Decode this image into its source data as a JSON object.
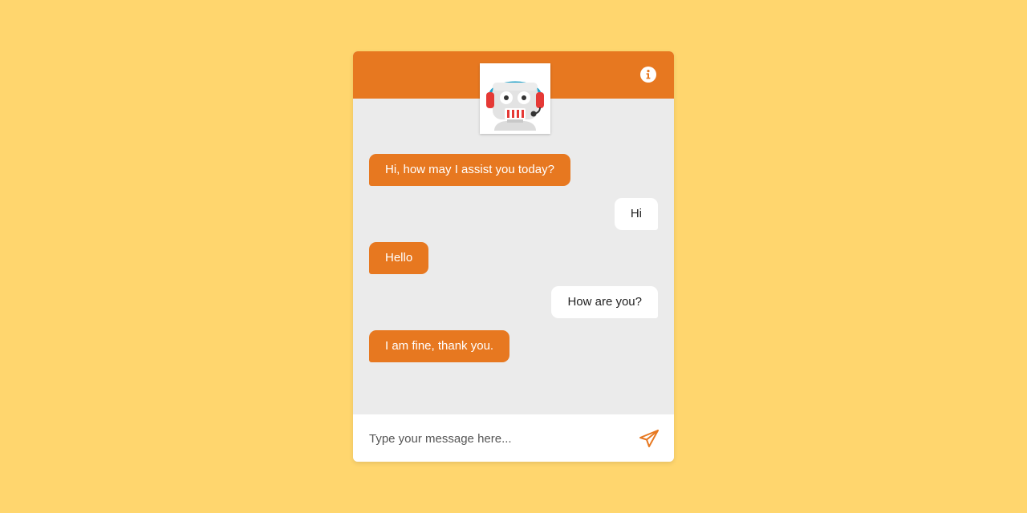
{
  "theme": {
    "background": "#FFD66E",
    "accent": "#E77820",
    "panel": "#EBEBEB",
    "user_bubble": "#FFFFFF"
  },
  "header": {
    "avatar_icon": "robot-headset-icon",
    "info_icon": "info-icon"
  },
  "messages": [
    {
      "sender": "bot",
      "text": "Hi, how may I assist you today?"
    },
    {
      "sender": "user",
      "text": "Hi"
    },
    {
      "sender": "bot",
      "text": "Hello"
    },
    {
      "sender": "user",
      "text": "How are you?"
    },
    {
      "sender": "bot",
      "text": "I am fine, thank you."
    }
  ],
  "composer": {
    "placeholder": "Type your message here...",
    "value": "",
    "send_icon": "paper-plane-icon"
  }
}
